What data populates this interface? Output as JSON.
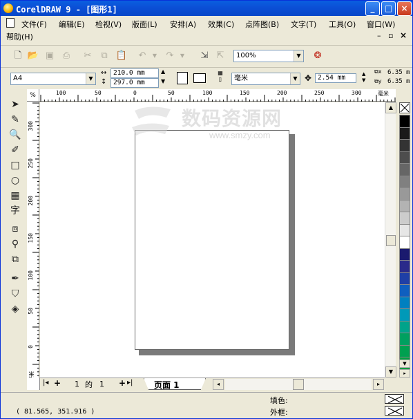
{
  "window": {
    "title": "CorelDRAW 9 - [图形1]",
    "controls": {
      "minimize": "_",
      "maximize": "□",
      "close": "×"
    }
  },
  "menu": {
    "items": [
      {
        "label": "文件(F)",
        "key": "file"
      },
      {
        "label": "编辑(E)",
        "key": "edit"
      },
      {
        "label": "检视(V)",
        "key": "view"
      },
      {
        "label": "版面(L)",
        "key": "layout"
      },
      {
        "label": "安排(A)",
        "key": "arrange"
      },
      {
        "label": "效果(C)",
        "key": "effects"
      },
      {
        "label": "点阵图(B)",
        "key": "bitmaps"
      },
      {
        "label": "文字(T)",
        "key": "text"
      },
      {
        "label": "工具(O)",
        "key": "tools"
      },
      {
        "label": "窗口(W)",
        "key": "window"
      },
      {
        "label": "帮助(H)",
        "key": "help"
      }
    ]
  },
  "toolbar": {
    "zoom": "100%"
  },
  "property_bar": {
    "paper_size": "A4",
    "width": "210.0 mm",
    "height": "297.0 mm",
    "units": "毫米",
    "nudge": "2.54 mm",
    "dup_x": "6.35 m",
    "dup_y": "6.35 m"
  },
  "ruler": {
    "corner": "%",
    "h_ticks": [
      "100",
      "50",
      "0",
      "50",
      "100",
      "150",
      "200",
      "250",
      "300"
    ],
    "h_unit": "毫米",
    "v_ticks": [
      "300",
      "250",
      "200",
      "150",
      "100",
      "50",
      "0"
    ],
    "v_unit": "毫米"
  },
  "watermark": {
    "text": "数码资源网",
    "url": "www.smzy.com"
  },
  "page_nav": {
    "current": "1",
    "of_label": "的",
    "total": "1",
    "tab_label": "页面 1"
  },
  "status": {
    "coords": "( 81.565, 351.916 )",
    "fill_label": "填色:",
    "outline_label": "外框:"
  },
  "palette": {
    "colors": [
      "#000000",
      "#1a1a1a",
      "#333333",
      "#4d4d4d",
      "#666666",
      "#808080",
      "#999999",
      "#b3b3b3",
      "#cccccc",
      "#e6e6e6",
      "#ffffff",
      "#1a1a6e",
      "#2a2a8a",
      "#1f3fa6",
      "#0f5fbf",
      "#0080c0",
      "#0099b8",
      "#00a38a",
      "#00a060",
      "#00a050",
      "#009f40"
    ]
  }
}
